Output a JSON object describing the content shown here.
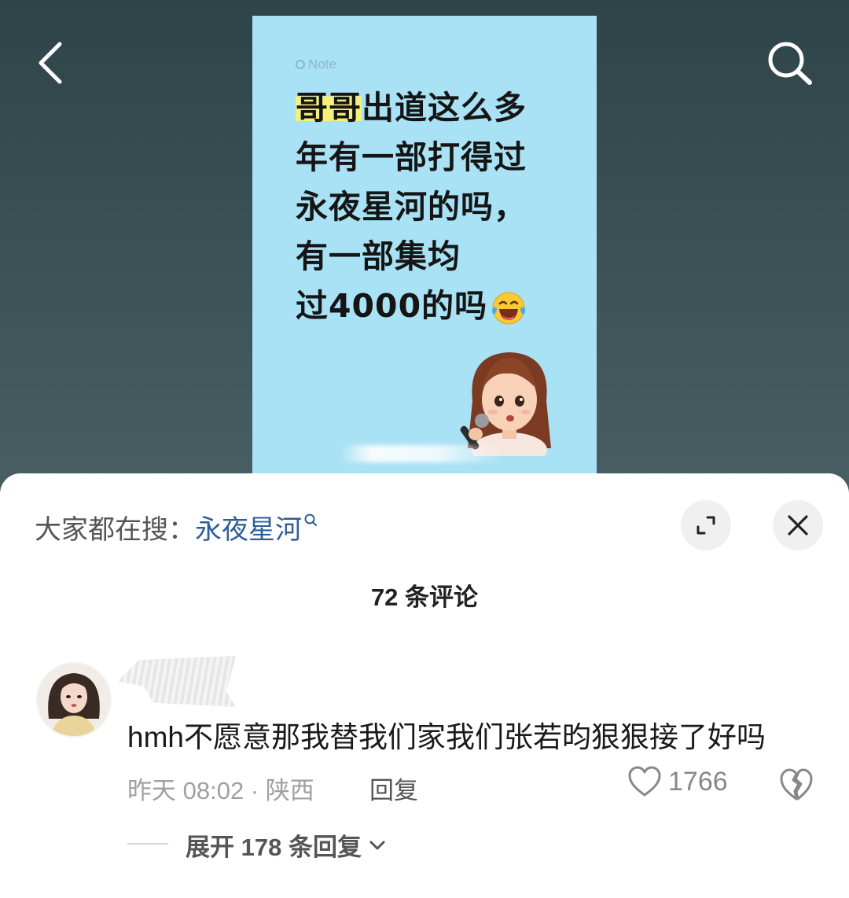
{
  "nav": {
    "back_icon": "chevron-left-icon",
    "search_icon": "search-icon"
  },
  "note_card": {
    "brand": "Note",
    "highlight": "哥哥",
    "lines": [
      "出道这么多",
      "年有一部打得过",
      "永夜星河的吗，",
      "有一部集均",
      "过4000的吗"
    ],
    "emoji": "laughing-with-tears-emoji",
    "illustration": "girl-singing-with-microphone",
    "bg_color": "#a9e1f5",
    "highlight_color": "#f5f07a"
  },
  "sheet": {
    "trending_label": "大家都在搜：",
    "trending_keyword": "永夜星河",
    "keyword_color": "#2f5d98",
    "expand_icon": "expand-icon",
    "close_icon": "close-icon",
    "comment_count": "72 条评论"
  },
  "comment": {
    "text": "hmh不愿意那我替我们家我们张若昀狠狠接了好吗",
    "time_location": "昨天 08:02 · 陕西",
    "reply_label": "回复",
    "likes": "1766",
    "like_icon": "heart-icon",
    "dislike_icon": "broken-heart-icon",
    "expand_replies": "展开 178 条回复"
  }
}
